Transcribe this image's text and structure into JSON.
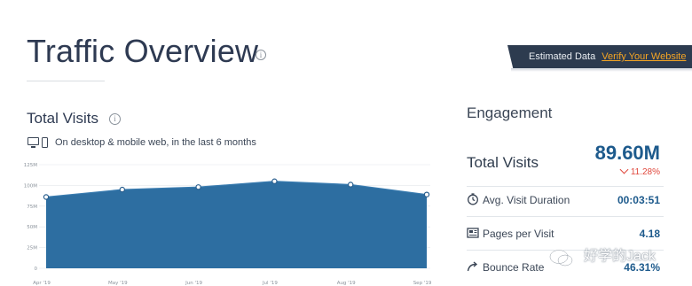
{
  "header": {
    "title": "Traffic Overview"
  },
  "banner": {
    "label": "Estimated Data",
    "link": "Verify Your Website",
    "bg_color": "#2d3b4f",
    "link_color": "#f5a524"
  },
  "visits": {
    "title": "Total Visits",
    "subtitle": "On desktop & mobile web, in the last 6 months"
  },
  "chart_data": {
    "type": "area",
    "categories": [
      "Apr '19",
      "May '19",
      "Jun '19",
      "Jul '19",
      "Aug '19",
      "Sep '19"
    ],
    "series": [
      {
        "values": [
          8.6,
          9.5,
          9.8,
          10.5,
          10.1,
          8.9
        ]
      }
    ],
    "y_ticks": [
      "0",
      "25M",
      "50M",
      "75M",
      "100M",
      "125M"
    ],
    "y_tick_values": [
      0,
      2.5,
      5,
      7.5,
      10,
      12.5
    ],
    "ylim": [
      0,
      12.5
    ],
    "grid": true,
    "fill_color": "#2d6ea1",
    "line_color": "#3a7cb0"
  },
  "engagement": {
    "title": "Engagement",
    "total": {
      "label": "Total Visits",
      "value": "89.60M",
      "change": "11.28%",
      "change_color": "#e0473c"
    },
    "metrics": [
      {
        "icon": "clock-icon",
        "label": "Avg. Visit Duration",
        "value": "00:03:51"
      },
      {
        "icon": "pages-icon",
        "label": "Pages per Visit",
        "value": "4.18"
      },
      {
        "icon": "bounce-icon",
        "label": "Bounce Rate",
        "value": "46.31%"
      }
    ]
  },
  "watermark": {
    "text": "好学的Jack"
  }
}
